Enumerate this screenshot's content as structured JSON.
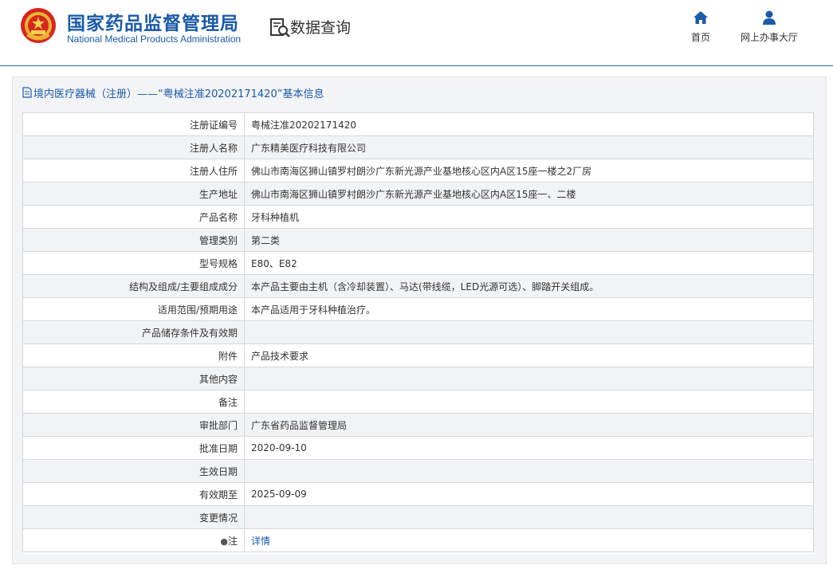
{
  "header": {
    "brand_cn": "国家药品监督管理局",
    "brand_en": "National Medical Products Administration",
    "query_title": "数据查询",
    "nav": [
      {
        "label": "首页",
        "icon": "home-icon"
      },
      {
        "label": "网上办事大厅",
        "icon": "user-icon"
      }
    ]
  },
  "panel": {
    "title": "境内医疗器械（注册）——“粤械注准20202171420”基本信息",
    "rows": [
      {
        "label": "注册证编号",
        "value": "粤械注准20202171420"
      },
      {
        "label": "注册人名称",
        "value": "广东精美医疗科技有限公司"
      },
      {
        "label": "注册人住所",
        "value": "佛山市南海区狮山镇罗村朗沙广东新光源产业基地核心区内A区15座一楼之2厂房"
      },
      {
        "label": "生产地址",
        "value": "佛山市南海区狮山镇罗村朗沙广东新光源产业基地核心区内A区15座一、二楼"
      },
      {
        "label": "产品名称",
        "value": "牙科种植机"
      },
      {
        "label": "管理类别",
        "value": "第二类"
      },
      {
        "label": "型号规格",
        "value": "E80、E82"
      },
      {
        "label": "结构及组成/主要组成成分",
        "value": "本产品主要由主机（含冷却装置）、马达(带线缆，LED光源可选）、脚踏开关组成。"
      },
      {
        "label": "适用范围/预期用途",
        "value": "本产品适用于牙科种植治疗。"
      },
      {
        "label": "产品储存条件及有效期",
        "value": ""
      },
      {
        "label": "附件",
        "value": "产品技术要求"
      },
      {
        "label": "其他内容",
        "value": ""
      },
      {
        "label": "备注",
        "value": ""
      },
      {
        "label": "审批部门",
        "value": "广东省药品监督管理局"
      },
      {
        "label": "批准日期",
        "value": "2020-09-10"
      },
      {
        "label": "生效日期",
        "value": ""
      },
      {
        "label": "有效期至",
        "value": "2025-09-09"
      },
      {
        "label": "变更情况",
        "value": ""
      }
    ],
    "note_row": {
      "label": "注",
      "link": "详情"
    }
  },
  "colors": {
    "brand_blue": "#1a5aa8",
    "panel_bg": "#f3f4f6",
    "row_alt": "#f2f3f5",
    "border": "#d6d8db"
  }
}
